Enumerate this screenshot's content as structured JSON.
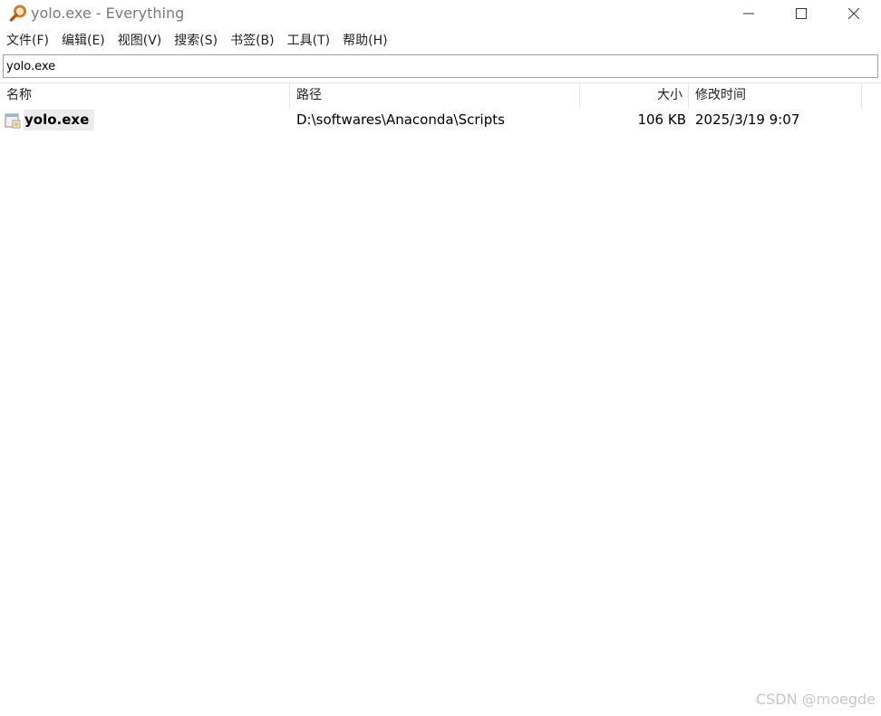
{
  "window": {
    "title": "yolo.exe - Everything"
  },
  "menu": {
    "items": [
      "文件(F)",
      "编辑(E)",
      "视图(V)",
      "搜索(S)",
      "书签(B)",
      "工具(T)",
      "帮助(H)"
    ]
  },
  "search": {
    "value": "yolo.exe"
  },
  "columns": {
    "name": "名称",
    "path": "路径",
    "size": "大小",
    "mtime": "修改时间"
  },
  "results": [
    {
      "name": "yolo.exe",
      "path": "D:\\softwares\\Anaconda\\Scripts",
      "size": "106 KB",
      "mtime": "2025/3/19 9:07"
    }
  ],
  "watermark": "CSDN @moegde",
  "icons": {
    "app": "magnifier-icon",
    "file": "exe-file-icon"
  },
  "colors": {
    "accent": "#e07820",
    "selection": "#ececec"
  }
}
